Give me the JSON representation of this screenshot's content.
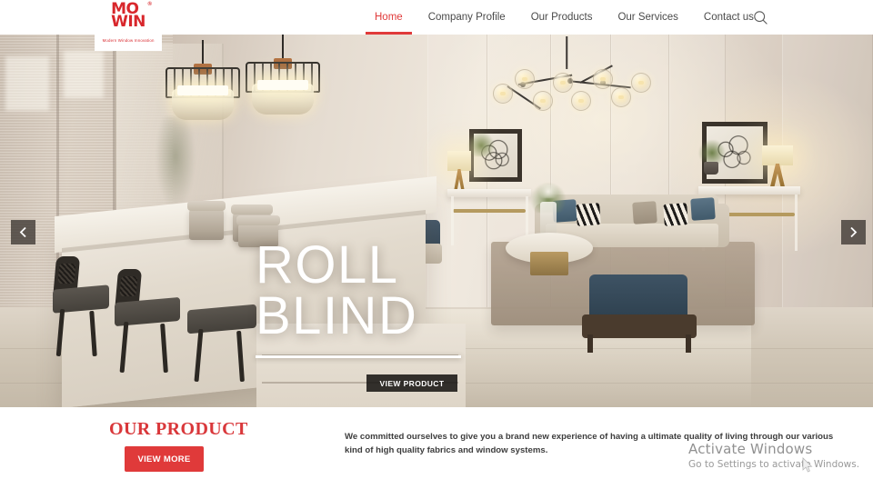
{
  "header": {
    "logo": {
      "line1": "MO",
      "line2": "WIN",
      "registered": "®",
      "tagline": "Modern Window Innovation"
    },
    "nav": [
      {
        "label": "Home",
        "active": true
      },
      {
        "label": "Company Profile",
        "active": false
      },
      {
        "label": "Our Products",
        "active": false
      },
      {
        "label": "Our Services",
        "active": false
      },
      {
        "label": "Contact us",
        "active": false
      }
    ],
    "search_icon": "search-icon"
  },
  "hero": {
    "title_line1": "ROLL",
    "title_line2": "BLIND",
    "cta_label": "VIEW PRODUCT",
    "prev_icon": "chevron-left-icon",
    "next_icon": "chevron-right-icon",
    "scene_description": "Luxury interior living room with roller blinds, kitchen island, bar stools, cage pendant lights and bubble chandelier"
  },
  "bottom": {
    "section_title": "OUR PRODUCT",
    "view_more_label": "VIEW MORE",
    "description": "We committed ourselves to give you a brand new experience of having a ultimate quality of living through our various kind of high quality fabrics and window systems."
  },
  "watermark": {
    "line1": "Activate Windows",
    "line2": "Go to Settings to activate Windows."
  },
  "colors": {
    "accent_red": "#e03a3a",
    "logo_red": "#d8272c",
    "title_red": "#d9383b",
    "nav_text": "#4a4a4a",
    "hero_text": "#ffffff",
    "cta_dark": "#191715"
  }
}
